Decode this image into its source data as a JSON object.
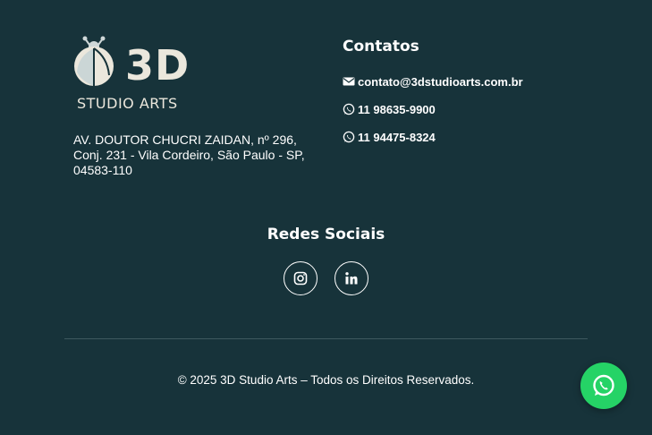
{
  "logo": {
    "brand": "3D",
    "subtitle": "STUDIO ARTS",
    "icon": "ladybug-logo-icon"
  },
  "address": "AV. DOUTOR CHUCRI ZAIDAN, nº 296, Conj. 231 - Vila Cordeiro, São Paulo - SP, 04583-110",
  "contacts": {
    "title": "Contatos",
    "items": [
      {
        "icon": "envelope-icon",
        "text": "contato@3dstudioarts.com.br"
      },
      {
        "icon": "whatsapp-icon",
        "text": "11 98635-9900"
      },
      {
        "icon": "whatsapp-icon",
        "text": "11 94475-8324"
      }
    ]
  },
  "social": {
    "title": "Redes Sociais",
    "links": [
      {
        "icon": "instagram-icon"
      },
      {
        "icon": "linkedin-icon"
      }
    ]
  },
  "copyright": "© 2025 3D Studio Arts – Todos os Direitos Reservados.",
  "fab": {
    "icon": "whatsapp-icon"
  },
  "colors": {
    "background": "#17333a",
    "logo": "#ebe7dc",
    "whatsapp": "#25d366",
    "divider": "#3e585e"
  }
}
